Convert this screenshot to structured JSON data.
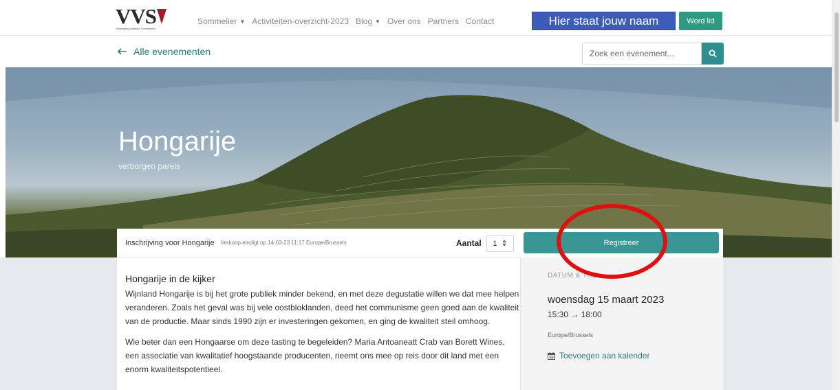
{
  "logo": {
    "text": "VVS",
    "subtitle": "Vereniging Vlaamse Sommeliers"
  },
  "nav": {
    "items": [
      {
        "label": "Sommelier",
        "dropdown": true
      },
      {
        "label": "Activiteiten-overzicht-2023",
        "dropdown": false
      },
      {
        "label": "Blog",
        "dropdown": true
      },
      {
        "label": "Over ons",
        "dropdown": false
      },
      {
        "label": "Partners",
        "dropdown": false
      },
      {
        "label": "Contact",
        "dropdown": false
      }
    ],
    "caret": "▼",
    "user_name": "Hier staat jouw naam",
    "join_label": "Word lid"
  },
  "subbar": {
    "back_label": "Alle evenementen",
    "search_placeholder": "Zoek een evenement..."
  },
  "hero": {
    "title": "Hongarije",
    "subtitle": "verborgen parels"
  },
  "ticket": {
    "name": "Inschrijving voor Hongarije",
    "sale_end": "Verkoop eindigt op 14-03-23 11:17 Europe/Brussels",
    "qty_label": "Aantal",
    "qty_value": "1",
    "qty_arrows": "⇕",
    "register_label": "Registreer"
  },
  "description": {
    "heading": "Hongarije in de kijker",
    "paragraphs": [
      "Wijnland Hongarije is bij het grote publiek minder bekend, en met deze degustatie willen we dat mee helpen veranderen. Zoals het geval was bij vele oostbloklanden, deed het communisme geen goed aan de kwaliteit van de productie. Maar sinds 1990 zijn er investeringen gekomen, en ging de kwaliteit steil omhoog.",
      "Wie beter dan een Hongaarse om deze tasting te begeleiden? Maria Antoaneatt Crab van Borett Wines, een associatie van kwalitatief hoogstaande producenten, neemt ons mee op reis door dit land met een enorm kwaliteitspotentieel."
    ]
  },
  "datetime": {
    "label": "DATUM & TIJD",
    "date": "woensdag 15 maart 2023",
    "time": "15:30 → 18:00",
    "timezone": "Europe/Brussels",
    "calendar_label": "Toevoegen aan kalender"
  },
  "colors": {
    "accent_teal": "#3a9695",
    "brand_red": "#a21b2b",
    "name_box_blue": "#3b5db8",
    "annotation_red": "#e01010"
  }
}
